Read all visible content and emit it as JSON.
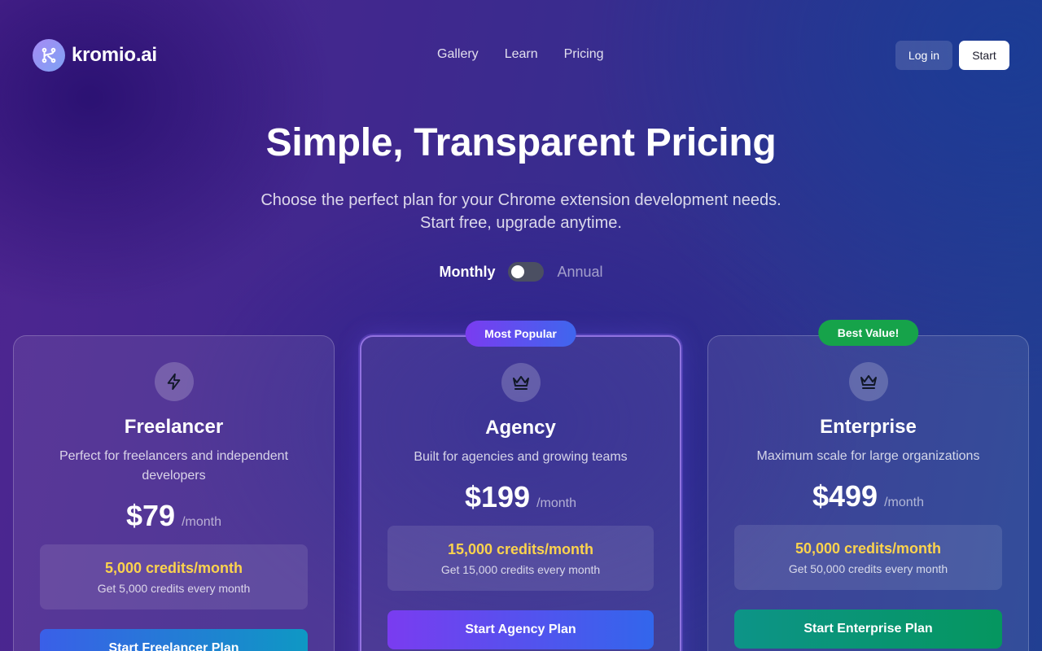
{
  "brand": {
    "name": "kromio.ai"
  },
  "nav": {
    "items": [
      "Gallery",
      "Learn",
      "Pricing"
    ]
  },
  "auth": {
    "login_label": "Log in",
    "start_label": "Start"
  },
  "hero": {
    "title": "Simple, Transparent Pricing",
    "subtitle_line1": "Choose the perfect plan for your Chrome extension development needs.",
    "subtitle_line2": "Start free, upgrade anytime."
  },
  "billing": {
    "monthly_label": "Monthly",
    "annual_label": "Annual",
    "selected": "Monthly"
  },
  "plans": [
    {
      "icon": "lightning-icon",
      "name": "Freelancer",
      "description": "Perfect for freelancers and independent developers",
      "price": "$79",
      "period": "/month",
      "credits": "5,000 credits/month",
      "credits_note": "Get 5,000 credits every month",
      "cta": "Start Freelancer Plan"
    },
    {
      "badge": "Most Popular",
      "icon": "crown-icon",
      "name": "Agency",
      "description": "Built for agencies and growing teams",
      "price": "$199",
      "period": "/month",
      "credits": "15,000 credits/month",
      "credits_note": "Get 15,000 credits every month",
      "cta": "Start Agency Plan"
    },
    {
      "badge": "Best Value!",
      "icon": "crown-icon",
      "name": "Enterprise",
      "description": "Maximum scale for large organizations",
      "price": "$499",
      "period": "/month",
      "credits": "50,000 credits/month",
      "credits_note": "Get 50,000 credits every month",
      "cta": "Start Enterprise Plan"
    }
  ],
  "colors": {
    "credits_highlight": "#fcd34d",
    "badge_popular": "#7a3cf0",
    "badge_value": "#16a34a",
    "cta_freelancer": "#3a5fe8",
    "cta_agency": "#7a3cf0",
    "cta_enterprise": "#0d9488"
  }
}
